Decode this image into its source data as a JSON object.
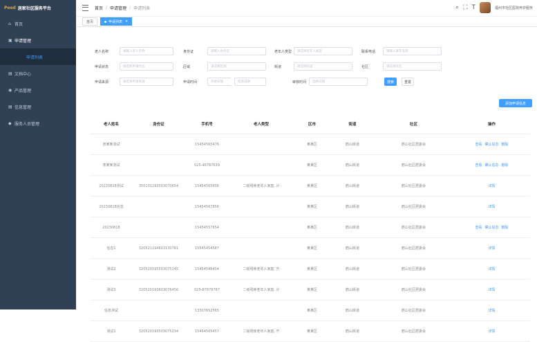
{
  "app": {
    "brand": "Peed",
    "title": "居家社区服务平台"
  },
  "sidebar": {
    "items": [
      {
        "icon": "home-icon",
        "glyph": "⌂",
        "label": "首页"
      },
      {
        "icon": "apply-icon",
        "glyph": "▣",
        "label": "申请管理",
        "open": true
      },
      {
        "icon": "doc-icon",
        "glyph": "▤",
        "label": "文档中心"
      },
      {
        "icon": "product-icon",
        "glyph": "◉",
        "label": "产品管理"
      },
      {
        "icon": "info-icon",
        "glyph": "▤",
        "label": "信息管理"
      },
      {
        "icon": "user-icon",
        "glyph": "◆",
        "label": "服务人员管理"
      }
    ],
    "sub_item": "申请列表"
  },
  "header": {
    "breadcrumb": [
      "首页",
      "申请管理",
      "申请列表"
    ],
    "tools": {
      "search": "⌕",
      "fullscreen": "⛶",
      "font": "T"
    },
    "username": "福州市社区医院养护服务"
  },
  "tags": [
    {
      "label": "首页",
      "active": false
    },
    {
      "label": "申请列表",
      "active": true
    }
  ],
  "filters": {
    "row1": [
      {
        "label": "老人名称",
        "placeholder": "请输入老人名称"
      },
      {
        "label": "身份证",
        "placeholder": "请输入身份证"
      },
      {
        "label": "老年人类型",
        "placeholder": "请选择老年人类型"
      },
      {
        "label": "联系电话",
        "placeholder": "请输入联系电话"
      }
    ],
    "row2": [
      {
        "label": "申请状态",
        "placeholder": "请选择申请状态"
      },
      {
        "label": "区域",
        "placeholder": "请选择区域"
      },
      {
        "label": "街道",
        "placeholder": "请选择街道"
      },
      {
        "label": "社区",
        "placeholder": "请选择社区"
      }
    ],
    "row3": [
      {
        "label": "申请来源",
        "placeholder": "请选择申请来源"
      },
      {
        "label": "申请时间",
        "start": "开始日期",
        "end": "结束日期"
      },
      {
        "label": "审核时间",
        "start": "选择日期"
      }
    ],
    "search_btn": "搜索",
    "reset_btn": "重置",
    "add_btn": "添加申请信息"
  },
  "table": {
    "headers": [
      "老人姓名",
      "身份证",
      "手机号",
      "老人类型",
      "区市",
      "街道",
      "社区",
      "操作"
    ],
    "rows": [
      {
        "name": "张某某测试",
        "id": "",
        "phone": "15454565476",
        "type": "",
        "district": "某某区",
        "street": "鹤山街道",
        "community": "鹤山社区居委会",
        "ops": [
          "查看",
          "确认信息",
          "删除"
        ]
      },
      {
        "name": "李某某测试",
        "id": "",
        "phone": "025-46787639",
        "type": "",
        "district": "某某区",
        "street": "鹤山街道",
        "community": "鹤山社区居委会",
        "ops": [
          "查看",
          "确认信息",
          "删除"
        ]
      },
      {
        "name": "20220818测试",
        "id": "350101193503070654",
        "phone": "15454565656",
        "type": "二级残疾老年人家庭, 计",
        "district": "某某区",
        "street": "鹤山街道",
        "community": "鹤山社区居委会",
        "ops": [
          "详情"
        ]
      },
      {
        "name": "20230818信息",
        "id": "",
        "phone": "15454567856",
        "type": "",
        "district": "某某区",
        "street": "鹤山街道",
        "community": "鹤山社区居委会",
        "ops": [
          "详情"
        ]
      },
      {
        "name": "20230818",
        "id": "",
        "phone": "15454557654",
        "type": "",
        "district": "某某区",
        "street": "鹤山街道",
        "community": "鹤山社区居委会",
        "ops": [
          "查看",
          "确认信息",
          "删除"
        ]
      },
      {
        "name": "信息1",
        "id": "320521194603130781",
        "phone": "15545454587",
        "type": "",
        "district": "某某区",
        "street": "鹤山街道",
        "community": "鹤山社区居委会",
        "ops": [
          "详情"
        ]
      },
      {
        "name": "测试2",
        "id": "320520195503075245",
        "phone": "15454545454",
        "type": "二级残疾老年人家庭, 升",
        "district": "某某区",
        "street": "鹤山街道",
        "community": "鹤山社区居委会",
        "ops": [
          "详情"
        ]
      },
      {
        "name": "测试3",
        "id": "320520193603076456",
        "phone": "025-87878787",
        "type": "二级残疾老年人家庭, 计",
        "district": "某某区",
        "street": "鹤山街道",
        "community": "鹤山社区居委会",
        "ops": [
          "详情"
        ]
      },
      {
        "name": "信息测试",
        "id": "",
        "phone": "13307652565",
        "type": "",
        "district": "某某区",
        "street": "鹤山街道",
        "community": "鹤山社区居委会",
        "ops": [
          "详情"
        ]
      },
      {
        "name": "测试1",
        "id": "320520193503075234",
        "phone": "15454565457",
        "type": "二级残疾老年人家庭, 升",
        "district": "某某区",
        "street": "鹤山街道",
        "community": "鹤山社区居委会",
        "ops": [
          "详情"
        ]
      }
    ]
  },
  "colors": {
    "sidebar": "#304156",
    "sidebar_sub": "#1f2d3d",
    "accent": "#409eff",
    "brand": "#f0a020"
  }
}
